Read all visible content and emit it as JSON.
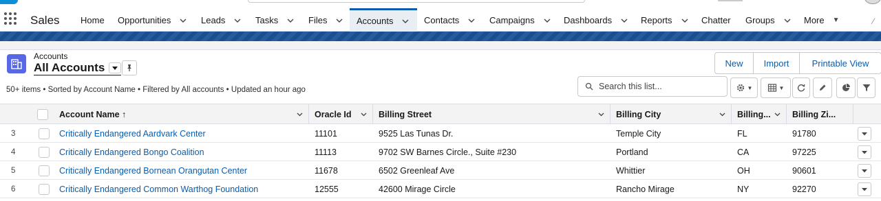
{
  "app": {
    "name": "Sales"
  },
  "nav": {
    "items": [
      {
        "label": "Home",
        "has_menu": false
      },
      {
        "label": "Opportunities",
        "has_menu": true
      },
      {
        "label": "Leads",
        "has_menu": true
      },
      {
        "label": "Tasks",
        "has_menu": true
      },
      {
        "label": "Files",
        "has_menu": true
      },
      {
        "label": "Accounts",
        "has_menu": true,
        "active": true
      },
      {
        "label": "Contacts",
        "has_menu": true
      },
      {
        "label": "Campaigns",
        "has_menu": true
      },
      {
        "label": "Dashboards",
        "has_menu": true
      },
      {
        "label": "Reports",
        "has_menu": true
      },
      {
        "label": "Chatter",
        "has_menu": false
      },
      {
        "label": "Groups",
        "has_menu": true
      },
      {
        "label": "More",
        "has_menu": true
      }
    ]
  },
  "list_header": {
    "object_label": "Accounts",
    "view_name": "All Accounts",
    "status": "50+ items • Sorted by Account Name • Filtered by All accounts • Updated an hour ago"
  },
  "actions": {
    "new": "New",
    "import": "Import",
    "printable_view": "Printable View"
  },
  "search": {
    "placeholder": "Search this list..."
  },
  "table": {
    "columns": [
      "Account Name ↑",
      "Oracle Id",
      "Billing Street",
      "Billing City",
      "Billing...",
      "Billing Zi..."
    ],
    "rows": [
      {
        "num": "3",
        "account_name": "Critically Endangered Aardvark Center",
        "oracle_id": "11101",
        "street": "9525 Las Tunas Dr.",
        "city": "Temple City",
        "state": "FL",
        "zip": "91780"
      },
      {
        "num": "4",
        "account_name": "Critically Endangered Bongo Coalition",
        "oracle_id": "11113",
        "street": "9702 SW Barnes Circle., Suite #230",
        "city": "Portland",
        "state": "CA",
        "zip": "97225"
      },
      {
        "num": "5",
        "account_name": "Critically Endangered Bornean Orangutan Center",
        "oracle_id": "11678",
        "street": "6502 Greenleaf Ave",
        "city": "Whittier",
        "state": "OH",
        "zip": "90601"
      },
      {
        "num": "6",
        "account_name": "Critically Endangered Common Warthog Foundation",
        "oracle_id": "12555",
        "street": "42600 Mirage Circle",
        "city": "Rancho Mirage",
        "state": "NY",
        "zip": "92270"
      }
    ]
  },
  "colors": {
    "accent": "#0b5cab",
    "band": "#1b5297",
    "object_icon": "#5867e8"
  },
  "icons": [
    "app-launcher-icon",
    "chevron-down-icon",
    "accounts-object-icon",
    "pin-icon",
    "search-icon",
    "gear-icon",
    "table-display-icon",
    "refresh-icon",
    "pencil-icon",
    "pie-chart-icon",
    "filter-icon"
  ]
}
